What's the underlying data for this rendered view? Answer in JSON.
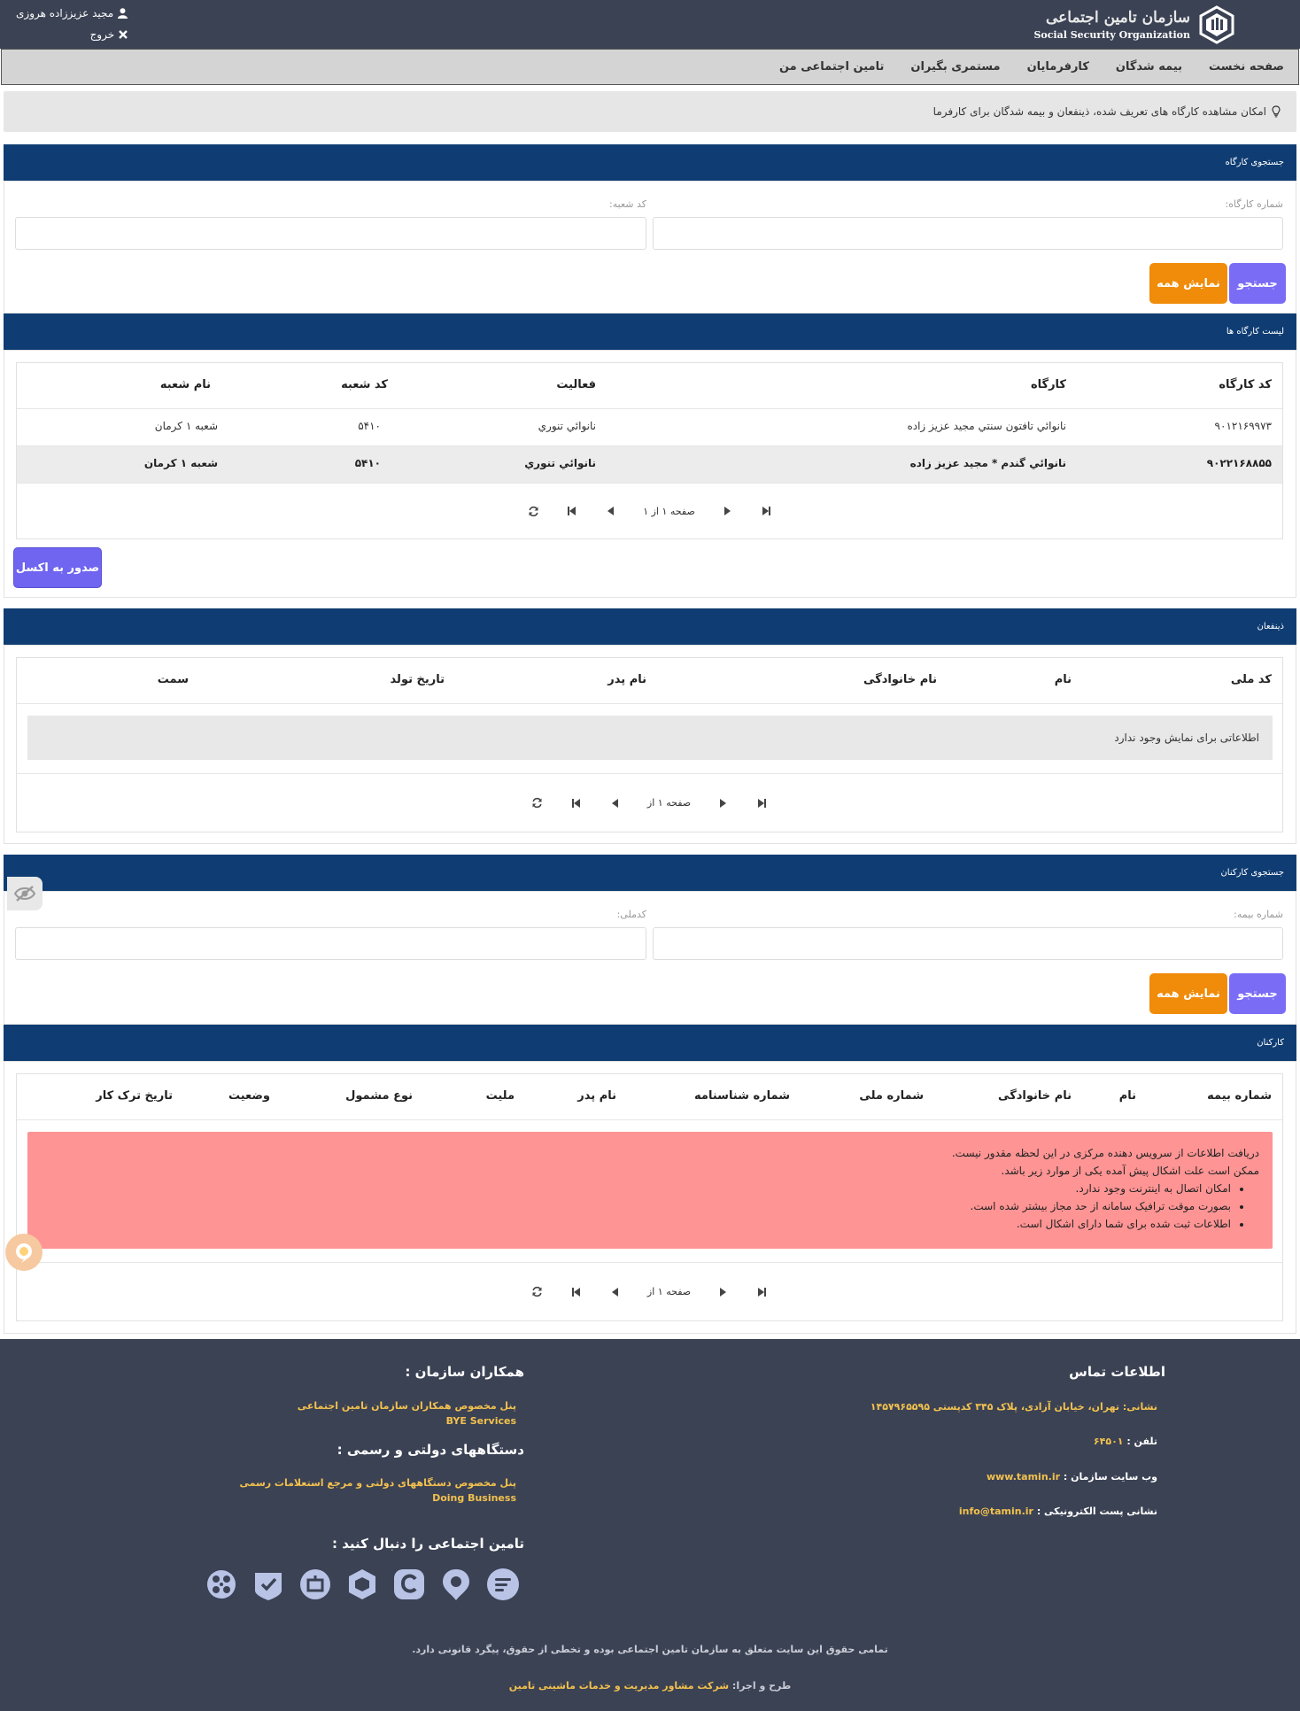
{
  "header": {
    "logo_fa": "سازمان تامین اجتماعی",
    "logo_en": "Social Security Organization",
    "user_name": "مجید عزیززاده هروزی",
    "logout": "خروج"
  },
  "nav": [
    "صفحه نخست",
    "بیمه شدگان",
    "کارفرمایان",
    "مستمری بگیران",
    "تامین اجتماعی من"
  ],
  "info_text": "امکان مشاهده کارگاه های تعریف شده، ذینفعان و بیمه شدگان برای کارفرما",
  "workshop_search": {
    "title": "جستجوی کارگاه",
    "field1_label": "شماره کارگاه:",
    "field2_label": "کد شعبه:",
    "search_btn": "جستجو",
    "showall_btn": "نمایش همه"
  },
  "workshop_list": {
    "title": "لیست کارگاه ها",
    "columns": [
      "کد کارگاه",
      "کارگاه",
      "فعالیت",
      "کد شعبه",
      "نام شعبه"
    ],
    "rows": [
      [
        "۹۰۱۲۱۶۹۹۷۳",
        "نانوائي تافتون سنتي مجيد عزيز زاده",
        "نانوائي تنوري",
        "۵۴۱۰",
        "شعبه ۱ کرمان"
      ],
      [
        "۹۰۲۲۱۶۸۸۵۵",
        "نانوائي گندم * مجيد عزيز زاده",
        "نانوائي تنوري",
        "۵۴۱۰",
        "شعبه ۱ کرمان"
      ]
    ],
    "pager_text": "صفحه ۱ از ۱",
    "excel_btn": "صدور به اکسل"
  },
  "beneficiaries": {
    "title": "ذینفعان",
    "columns": [
      "کد ملی",
      "نام",
      "نام خانوادگی",
      "نام پدر",
      "تاریخ تولد",
      "سمت"
    ],
    "empty_text": "اطلاعاتی برای نمایش وجود ندارد",
    "pager_text": "صفحه ۱ از"
  },
  "employee_search": {
    "title": "جستجوی کارکنان",
    "field1_label": "شماره بیمه:",
    "field2_label": "کدملی:",
    "search_btn": "جستجو",
    "showall_btn": "نمایش همه"
  },
  "employees": {
    "title": "کارکنان",
    "columns": [
      "شماره بیمه",
      "نام",
      "نام خانوادگی",
      "شماره ملی",
      "شماره شناسنامه",
      "نام پدر",
      "ملیت",
      "نوع مشمول",
      "وضعیت",
      "تاریخ ترک کار"
    ],
    "error_line1": "دریافت اطلاعات از سرویس دهنده مرکزی در این لحظه مقدور نیست.",
    "error_line2": "ممکن است علت اشکال پیش آمده یکی از موارد زیر باشد.",
    "error_items": [
      "امکان اتصال به اینترنت وجود ندارد.",
      "بصورت موقت ترافیک سامانه از حد مجاز بیشتر شده است.",
      "اطلاعات ثبت شده برای شما دارای اشکال است."
    ],
    "pager_text": "صفحه ۱ از"
  },
  "footer": {
    "contact_title": "اطلاعات تماس",
    "address": "نشانی: تهران، خیابان آزادی، پلاک ۳۴۵ کدپستی ۱۴۵۷۹۶۵۵۹۵",
    "phone_label": "تلفن :",
    "phone": "۶۴۵۰۱",
    "website_label": "وب سایت سازمان :",
    "website": "www.tamin.ir",
    "email_label": "نشانی پست الکترونیکی :",
    "email": "info@tamin.ir",
    "partners_title": "همکاران سازمان :",
    "partners_link1": "پنل مخصوص همکاران سازمان تامین اجتماعی",
    "partners_link2": "BYE Services",
    "gov_title": "دستگاههای دولتی و رسمی :",
    "gov_link1": "پنل مخصوص دستگاههای دولتی و مرجع استعلامات رسمی",
    "gov_link2": "Doing Business",
    "follow_title": "تامین اجتماعی را دنبال کنید :",
    "social_icons": [
      "eitaa-icon",
      "gap-icon",
      "rubika-icon",
      "soroush-icon",
      "bale-icon",
      "igap-icon",
      "aparat-icon"
    ],
    "copyright": "تمامی حقوق این سایت متعلق به سازمان تامین اجتماعی بوده و تخطی از حقوق، پیگرد قانونی دارد.",
    "design_label": "طرح و اجرا:",
    "design_company": "شرکت مشاور مدیریت و خدمات ماشینی تامین"
  },
  "colors": {
    "header_bg": "#3b4254",
    "panel_header": "#0f3d73",
    "search_btn": "#7b6cf6",
    "showall_btn": "#f08c0a",
    "error_bg": "#ff9494",
    "footer_link": "#f2c14e"
  }
}
